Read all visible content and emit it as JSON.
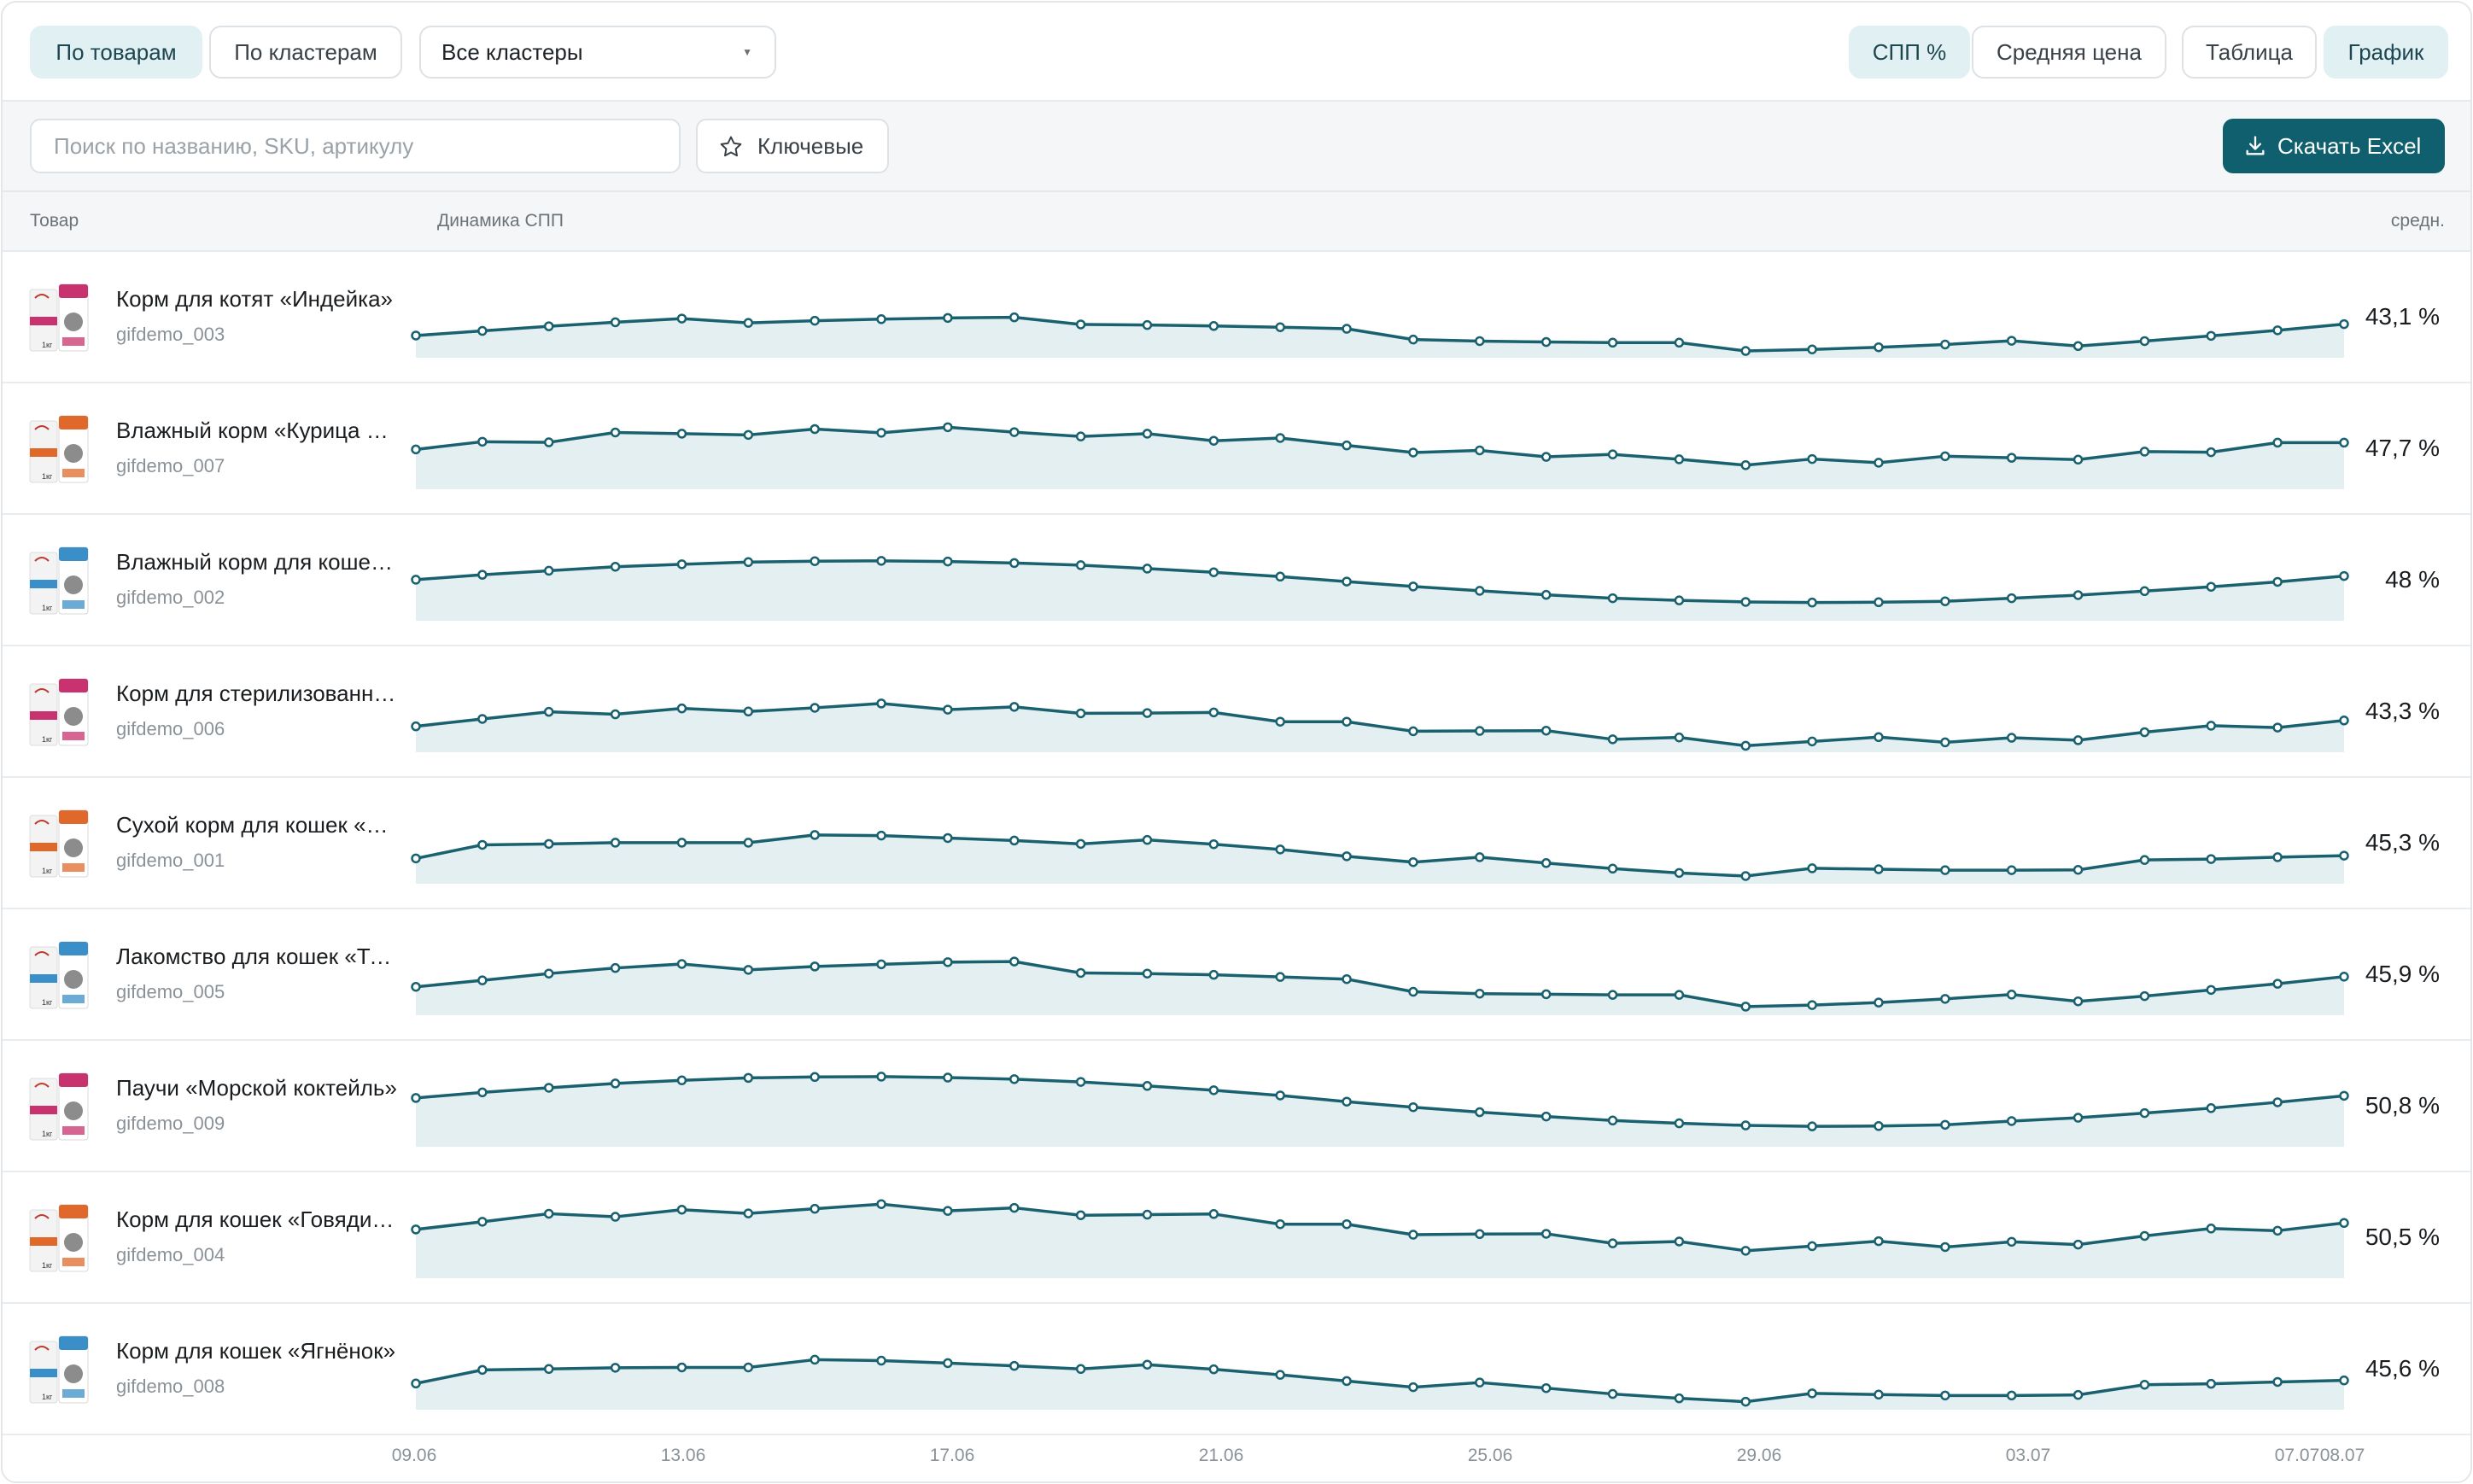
{
  "toolbar": {
    "view_by_products": "По товарам",
    "view_by_clusters": "По кластерам",
    "cluster_select": "Все кластеры",
    "metric_spp": "СПП %",
    "metric_avg_price": "Средняя цена",
    "mode_table": "Таблица",
    "mode_chart": "График"
  },
  "filters": {
    "search_placeholder": "Поиск по названию, SKU, артикулу",
    "key_label": "Ключевые",
    "excel_label": "Скачать Excel"
  },
  "columns": {
    "product": "Товар",
    "dynamics": "Динамика СПП",
    "avg": "средн."
  },
  "x_labels": [
    "09.06",
    "13.06",
    "17.06",
    "21.06",
    "25.06",
    "29.06",
    "03.07",
    "07.07",
    "08.07"
  ],
  "products": [
    {
      "name": "Корм для котят «Индейка»",
      "sku": "gifdemo_003",
      "avg": "43,1 %",
      "accent": "#c8326e",
      "series": [
        41.2,
        42.7,
        44.2,
        45.5,
        46.7,
        45.3,
        46.0,
        46.5,
        46.9,
        47.1,
        44.8,
        44.6,
        44.3,
        43.9,
        43.4,
        39.9,
        39.4,
        39.1,
        38.9,
        38.9,
        36.2,
        36.7,
        37.4,
        38.3,
        39.5,
        37.8,
        39.4,
        41.1,
        42.9,
        44.9
      ]
    },
    {
      "name": "Влажный корм «Курица с рисом»",
      "sku": "gifdemo_007",
      "avg": "47,7 %",
      "accent": "#e0682a",
      "series": [
        46.9,
        49.4,
        49.2,
        52.4,
        52.0,
        51.6,
        53.5,
        52.3,
        54.1,
        52.5,
        51.1,
        52.0,
        49.7,
        50.6,
        48.2,
        45.9,
        46.6,
        44.5,
        45.3,
        43.7,
        41.8,
        43.8,
        42.6,
        44.7,
        44.2,
        43.6,
        46.2,
        46.0,
        49.1,
        49.1
      ]
    },
    {
      "name": "Влажный корм для кошек «Лосось»",
      "sku": "gifdemo_002",
      "avg": "48 %",
      "accent": "#3a8fc8",
      "series": [
        47.3,
        48.9,
        50.2,
        51.5,
        52.3,
        53.0,
        53.3,
        53.4,
        53.2,
        52.7,
        52.0,
        50.9,
        49.7,
        48.3,
        46.7,
        45.1,
        43.7,
        42.4,
        41.3,
        40.6,
        40.1,
        39.9,
        40.0,
        40.3,
        41.3,
        42.3,
        43.6,
        45.0,
        46.6,
        48.5
      ]
    },
    {
      "name": "Корм для стерилизованных кошек",
      "sku": "gifdemo_006",
      "avg": "43,3 %",
      "accent": "#c8326e",
      "series": [
        42.4,
        44.8,
        47.1,
        46.3,
        48.2,
        47.2,
        48.4,
        49.8,
        47.8,
        48.7,
        46.6,
        46.7,
        46.9,
        43.9,
        43.9,
        40.8,
        40.9,
        41.0,
        38.2,
        38.8,
        36.1,
        37.5,
        38.9,
        37.2,
        38.7,
        37.9,
        40.5,
        42.6,
        42.0,
        44.3
      ]
    },
    {
      "name": "Сухой корм для кошек «Курица»",
      "sku": "gifdemo_001",
      "avg": "45,3 %",
      "accent": "#e0682a",
      "series": [
        42.2,
        46.6,
        46.9,
        47.3,
        47.3,
        47.3,
        49.8,
        49.6,
        48.8,
        48.0,
        46.9,
        48.2,
        46.8,
        45.1,
        42.9,
        41.0,
        42.6,
        40.7,
        38.9,
        37.5,
        36.5,
        39.0,
        38.7,
        38.4,
        38.4,
        38.5,
        41.7,
        42.0,
        42.6,
        43.1
      ]
    },
    {
      "name": "Лакомство для кошек «Тунец»",
      "sku": "gifdemo_005",
      "avg": "45,9 %",
      "accent": "#3a8fc8",
      "series": [
        43.2,
        45.3,
        47.5,
        49.3,
        50.6,
        48.7,
        49.8,
        50.5,
        51.2,
        51.4,
        47.7,
        47.5,
        47.1,
        46.4,
        45.7,
        41.6,
        41.0,
        40.8,
        40.6,
        40.6,
        36.8,
        37.3,
        38.1,
        39.3,
        40.7,
        38.5,
        40.2,
        42.2,
        44.2,
        46.5
      ]
    },
    {
      "name": "Паучи «Морской коктейль»",
      "sku": "gifdemo_009",
      "avg": "50,8 %",
      "accent": "#c8326e",
      "series": [
        49.8,
        51.6,
        53.1,
        54.5,
        55.5,
        56.3,
        56.6,
        56.7,
        56.4,
        55.9,
        55.0,
        53.7,
        52.3,
        50.6,
        48.6,
        46.8,
        45.2,
        43.8,
        42.5,
        41.6,
        40.9,
        40.6,
        40.7,
        41.1,
        42.3,
        43.4,
        44.9,
        46.5,
        48.4,
        50.5
      ]
    },
    {
      "name": "Корм для кошек «Говядина»",
      "sku": "gifdemo_004",
      "avg": "50,5 %",
      "accent": "#e0682a",
      "series": [
        49.8,
        52.3,
        54.9,
        53.9,
        56.2,
        55.0,
        56.5,
        58.0,
        55.8,
        56.8,
        54.4,
        54.6,
        54.8,
        51.5,
        51.5,
        48.1,
        48.3,
        48.4,
        45.3,
        45.9,
        42.9,
        44.4,
        46.0,
        44.1,
        45.8,
        44.9,
        47.7,
        50.1,
        49.4,
        51.9
      ]
    },
    {
      "name": "Корм для кошек «Ягнёнок»",
      "sku": "gifdemo_008",
      "avg": "45,6 %",
      "accent": "#3a8fc8",
      "series": [
        42.5,
        46.9,
        47.2,
        47.6,
        47.7,
        47.7,
        50.2,
        49.9,
        49.1,
        48.2,
        47.2,
        48.6,
        47.1,
        45.3,
        43.3,
        41.3,
        42.8,
        41.0,
        39.1,
        37.7,
        36.6,
        39.3,
        38.9,
        38.6,
        38.6,
        38.8,
        42.1,
        42.4,
        43.0,
        43.5
      ]
    }
  ],
  "colors": {
    "line": "#19616f",
    "fill": "#e4eff1",
    "accent": "#0f5f6e"
  }
}
